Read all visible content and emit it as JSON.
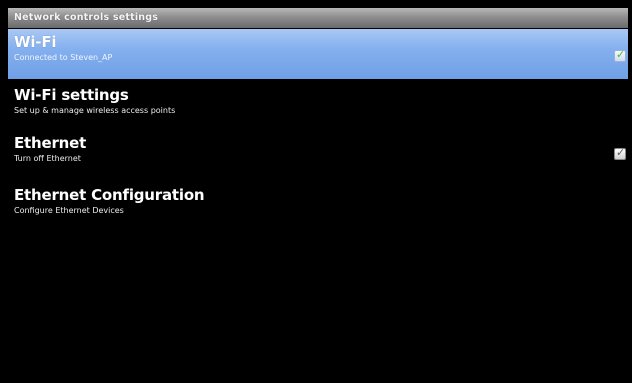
{
  "window": {
    "title": "Network controls settings"
  },
  "settings": {
    "items": [
      {
        "title": "Wi-Fi",
        "summary": "Connected to Steven_AP",
        "checked": true,
        "selected": true
      },
      {
        "title": "Wi-Fi settings",
        "summary": "Set up & manage wireless access points"
      },
      {
        "title": "Ethernet",
        "summary": "Turn off Ethernet",
        "checked": true
      },
      {
        "title": "Ethernet Configuration",
        "summary": "Configure Ethernet Devices"
      }
    ]
  },
  "icons": {
    "checkmark": "✓"
  },
  "colors": {
    "selected_row": "#84b0ee",
    "title_bar": "#8e8e8e",
    "background": "#000000",
    "wifi_checkmark": "#4cb82f"
  }
}
